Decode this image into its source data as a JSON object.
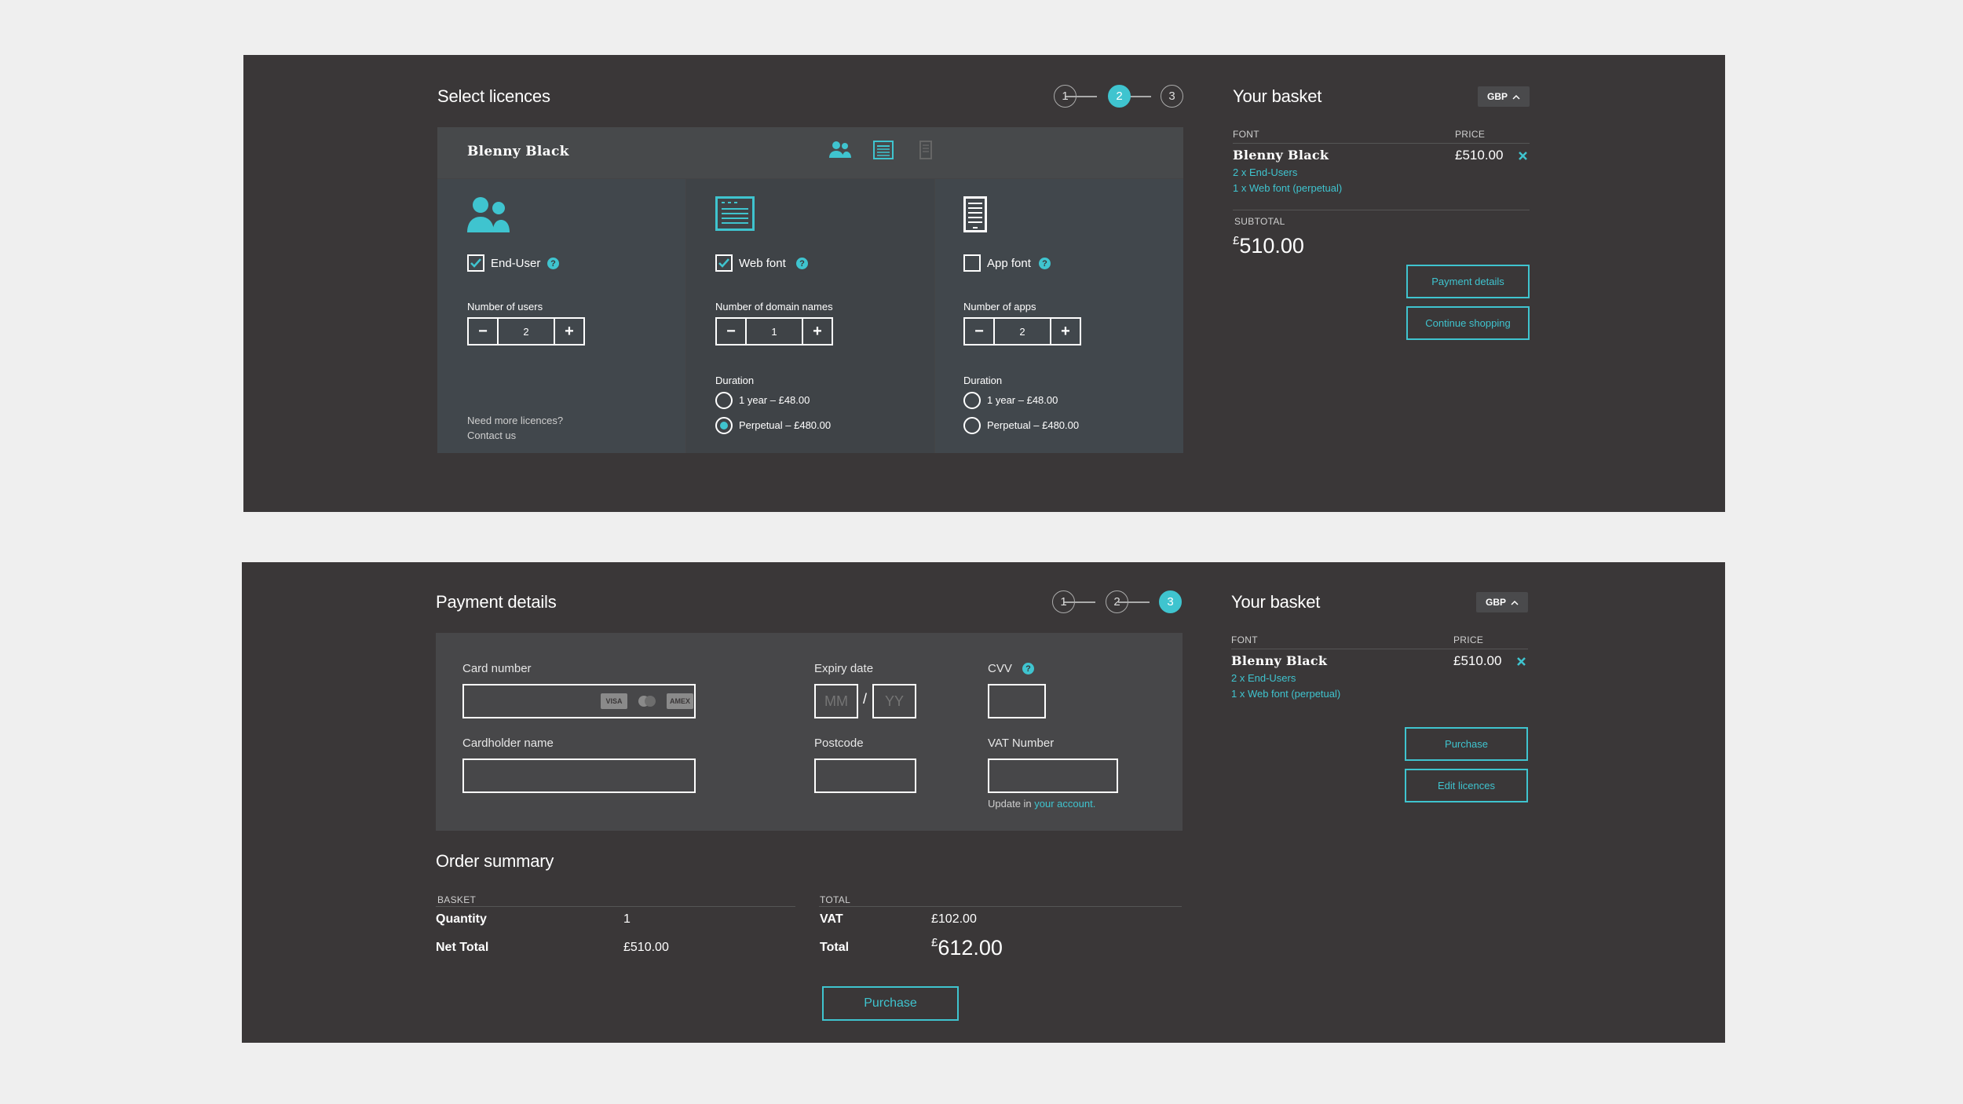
{
  "licences": {
    "title": "Select licences",
    "steps": [
      "1",
      "2",
      "3"
    ],
    "active_step": 2,
    "font_name": "Blenny Black",
    "columns": [
      {
        "option_label": "End-User",
        "checked": true,
        "icon": "users-icon",
        "count_label": "Number of users",
        "count": "2",
        "footer_line1": "Need more licences?",
        "footer_line2": "Contact us"
      },
      {
        "option_label": "Web font",
        "checked": true,
        "icon": "webpage-icon",
        "count_label": "Number of domain names",
        "count": "1",
        "duration_label": "Duration",
        "duration_options": [
          "1 year – £48.00",
          "Perpetual – £480.00"
        ],
        "duration_selected": 1
      },
      {
        "option_label": "App font",
        "checked": false,
        "icon": "mobile-app-icon",
        "count_label": "Number of apps",
        "count": "2",
        "duration_label": "Duration",
        "duration_options": [
          "1 year – £48.00",
          "Perpetual – £480.00"
        ],
        "duration_selected": -1
      }
    ]
  },
  "basket_top": {
    "title": "Your basket",
    "currency": "GBP",
    "col_font": "FONT",
    "col_price": "PRICE",
    "font_name": "Blenny Black",
    "price": "£510.00",
    "lines": [
      "2 x End-Users",
      "1 x Web font (perpetual)"
    ],
    "subtotal_label": "SUBTOTAL",
    "subtotal_currency": "£",
    "subtotal_value": "510.00",
    "btn_primary": "Payment details",
    "btn_secondary": "Continue shopping"
  },
  "payment": {
    "title": "Payment details",
    "steps": [
      "1",
      "2",
      "3"
    ],
    "active_step": 3,
    "card_number_label": "Card number",
    "card_icons": [
      "VISA",
      "MC",
      "AMEX"
    ],
    "expiry_label": "Expiry date",
    "expiry_mm": "MM",
    "expiry_sep": "/",
    "expiry_yy": "YY",
    "cvv_label": "CVV",
    "cardholder_label": "Cardholder name",
    "postcode_label": "Postcode",
    "vat_label": "VAT Number",
    "vat_hint_prefix": "Update in ",
    "vat_hint_link": "your account."
  },
  "order_summary": {
    "title": "Order summary",
    "basket_label": "BASKET",
    "total_label": "TOTAL",
    "quantity_label": "Quantity",
    "quantity_value": "1",
    "net_total_label": "Net Total",
    "net_total_value": "£510.00",
    "vat_label": "VAT",
    "vat_value": "£102.00",
    "total_row_label": "Total",
    "total_currency": "£",
    "total_value": "612.00",
    "purchase_button": "Purchase"
  },
  "basket_bottom": {
    "title": "Your basket",
    "currency": "GBP",
    "col_font": "FONT",
    "col_price": "PRICE",
    "font_name": "Blenny Black",
    "price": "£510.00",
    "lines": [
      "2 x End-Users",
      "1 x Web font (perpetual)"
    ],
    "btn_primary": "Purchase",
    "btn_secondary": "Edit licences"
  }
}
